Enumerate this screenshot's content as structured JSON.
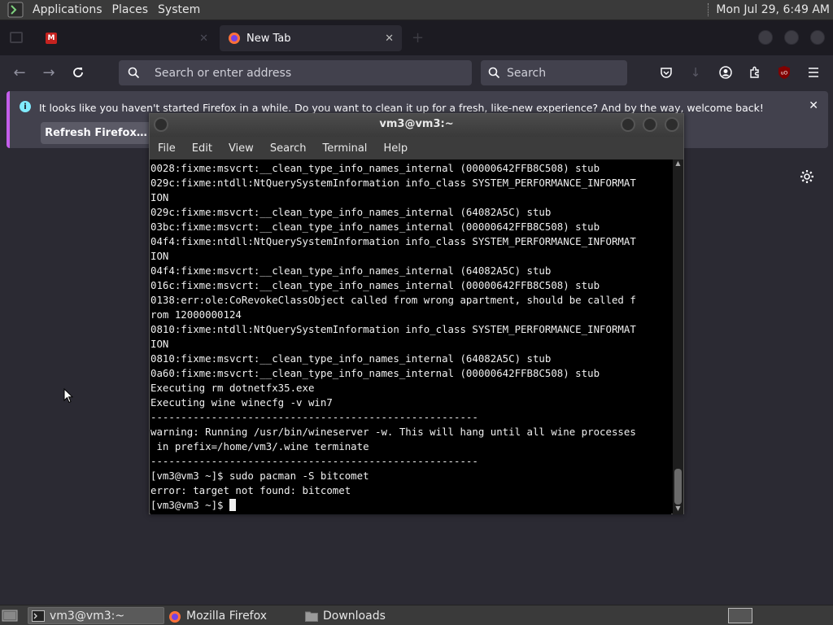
{
  "top_panel": {
    "menus": [
      "Applications",
      "Places",
      "System"
    ],
    "clock": "Mon Jul 29,  6:49 AM"
  },
  "firefox": {
    "tabs": [
      {
        "label": "",
        "favicon": "gmail-icon"
      },
      {
        "label": "New Tab",
        "favicon": "firefox-icon"
      }
    ],
    "url_placeholder": "Search or enter address",
    "search_placeholder": "Search",
    "notification": {
      "message": "It looks like you haven't started Firefox in a while. Do you want to clean it up for a fresh, like-new experience? And by the way, welcome back!",
      "button_label": "Refresh Firefox…"
    },
    "accent_color": "#c45eeb"
  },
  "terminal": {
    "title": "vm3@vm3:~",
    "menu": [
      "File",
      "Edit",
      "View",
      "Search",
      "Terminal",
      "Help"
    ],
    "lines": [
      "0028:fixme:msvcrt:__clean_type_info_names_internal (00000642FFB8C508) stub",
      "029c:fixme:ntdll:NtQuerySystemInformation info_class SYSTEM_PERFORMANCE_INFORMAT",
      "ION",
      "029c:fixme:msvcrt:__clean_type_info_names_internal (64082A5C) stub",
      "03bc:fixme:msvcrt:__clean_type_info_names_internal (00000642FFB8C508) stub",
      "04f4:fixme:ntdll:NtQuerySystemInformation info_class SYSTEM_PERFORMANCE_INFORMAT",
      "ION",
      "04f4:fixme:msvcrt:__clean_type_info_names_internal (64082A5C) stub",
      "016c:fixme:msvcrt:__clean_type_info_names_internal (00000642FFB8C508) stub",
      "0138:err:ole:CoRevokeClassObject called from wrong apartment, should be called f",
      "rom 12000000124",
      "0810:fixme:ntdll:NtQuerySystemInformation info_class SYSTEM_PERFORMANCE_INFORMAT",
      "ION",
      "0810:fixme:msvcrt:__clean_type_info_names_internal (64082A5C) stub",
      "0a60:fixme:msvcrt:__clean_type_info_names_internal (00000642FFB8C508) stub",
      "Executing rm dotnetfx35.exe",
      "Executing wine winecfg -v win7",
      "------------------------------------------------------",
      "warning: Running /usr/bin/wineserver -w. This will hang until all wine processes",
      " in prefix=/home/vm3/.wine terminate",
      "------------------------------------------------------",
      "[vm3@vm3 ~]$ sudo pacman -S bitcomet",
      "error: target not found: bitcomet"
    ],
    "prompt": "[vm3@vm3 ~]$ "
  },
  "taskbar": {
    "items": [
      {
        "label": "vm3@vm3:~",
        "icon": "terminal-icon",
        "active": true
      },
      {
        "label": "Mozilla Firefox",
        "icon": "firefox-icon",
        "active": false
      },
      {
        "label": "Downloads",
        "icon": "folder-icon",
        "active": false
      }
    ]
  }
}
